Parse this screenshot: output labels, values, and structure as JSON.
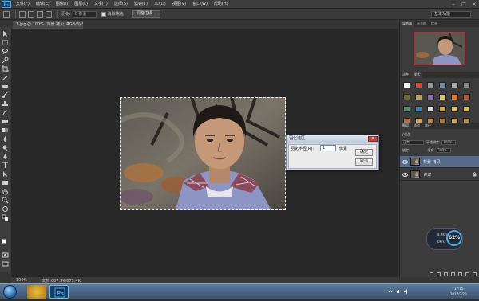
{
  "app": {
    "logo": "Ps",
    "menu": [
      "文件(F)",
      "编辑(E)",
      "图像(I)",
      "图层(L)",
      "文字(Y)",
      "选择(S)",
      "滤镜(T)",
      "3D(D)",
      "视图(V)",
      "窗口(W)",
      "帮助(H)"
    ],
    "window_controls": [
      "–",
      "□",
      "×"
    ]
  },
  "options_bar": {
    "feather_label": "羽化:",
    "feather_value": "0 像素",
    "antialias_label": "消除锯齿",
    "refine_edge_button": "调整边缘...",
    "workspace": "基本功能"
  },
  "document": {
    "tab_title": "1.jpg @ 100% (背景 拷贝, RGB/8) *",
    "zoom": "100%",
    "doc_size": "文档:687.9K/875.4K"
  },
  "feather_dialog": {
    "title": "羽化选区",
    "radius_label": "羽化半径(R):",
    "radius_value": "1",
    "unit": "像素",
    "ok_button": "确定",
    "cancel_button": "取消",
    "close": "×"
  },
  "panels": {
    "top_tabs": [
      "导航器",
      "直方图",
      "信息"
    ],
    "mid_tabs": [
      "调整",
      "样式"
    ],
    "layer_tabs": [
      "图层",
      "通道",
      "路径"
    ],
    "kind_label": "ρ类型",
    "blend_mode": "正常",
    "opacity_label": "不透明度:",
    "opacity_value": "100%",
    "lock_label": "锁定:",
    "fill_label": "填充:",
    "fill_value": "100%",
    "layers": [
      {
        "name": "背景 拷贝",
        "selected": true,
        "locked": false
      },
      {
        "name": "背景",
        "selected": false,
        "locked": true
      }
    ],
    "swatch_colors": [
      "#d24a3a",
      "#e07a2a",
      "#999999",
      "#6a8caa",
      "#4f6b3a",
      "#c2a060",
      "#8f6fb0",
      "#3c7fb0",
      "#b05a30",
      "#6b6b2a",
      "#d9c070",
      "#5a8a6a"
    ]
  },
  "net_meter": {
    "up": "8.2K/s",
    "down": "0K/s",
    "percent": "62%"
  },
  "taskbar": {
    "time": "17:15",
    "date": "2017/3/20"
  },
  "colors": {
    "accent_selected_layer": "#566b89",
    "navigator_frame": "#dd2233",
    "ps_blue": "#38b6ff"
  }
}
